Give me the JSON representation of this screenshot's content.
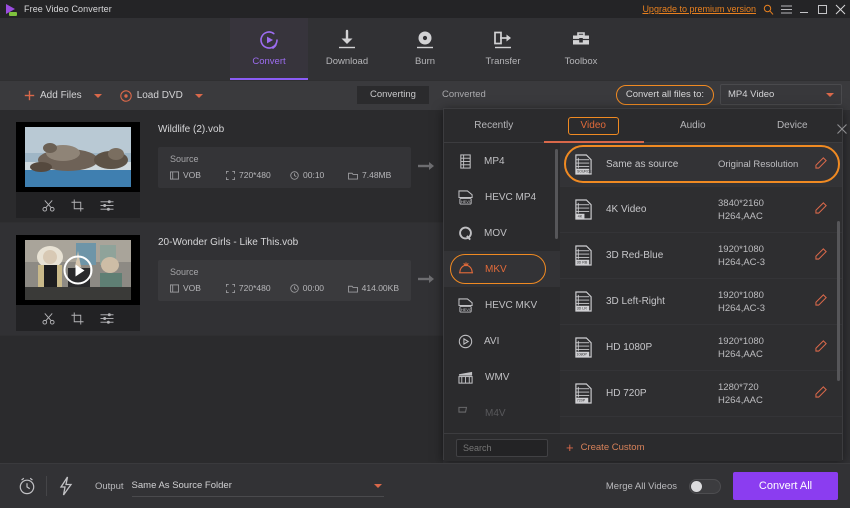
{
  "titlebar": {
    "app_title": "Free Video Converter",
    "upgrade_label": "Upgrade to premium version",
    "icons": [
      "search-icon",
      "menu-icon",
      "minimize-icon",
      "maximize-icon",
      "close-icon"
    ]
  },
  "nav": {
    "items": [
      {
        "label": "Convert",
        "icon": "convert-icon",
        "active": true
      },
      {
        "label": "Download",
        "icon": "download-icon",
        "active": false
      },
      {
        "label": "Burn",
        "icon": "burn-icon",
        "active": false
      },
      {
        "label": "Transfer",
        "icon": "transfer-icon",
        "active": false
      },
      {
        "label": "Toolbox",
        "icon": "toolbox-icon",
        "active": false
      }
    ]
  },
  "toolbar": {
    "add_files_label": "Add Files",
    "load_dvd_label": "Load DVD",
    "tabs": [
      {
        "label": "Converting",
        "active": true
      },
      {
        "label": "Converted",
        "active": false
      }
    ],
    "convert_all_to_label": "Convert all files to:",
    "convert_all_to_value": "MP4 Video"
  },
  "files": [
    {
      "name": "Wildlife  (2).vob",
      "source_label": "Source",
      "format": "VOB",
      "resolution": "720*480",
      "duration": "00:10",
      "size": "7.48MB",
      "playing": false
    },
    {
      "name": "20-Wonder Girls - Like This.vob",
      "source_label": "Source",
      "format": "VOB",
      "resolution": "720*480",
      "duration": "00:00",
      "size": "414.00KB",
      "playing": true
    }
  ],
  "panel": {
    "tabs": [
      {
        "label": "Recently",
        "active": false
      },
      {
        "label": "Video",
        "active": true
      },
      {
        "label": "Audio",
        "active": false
      },
      {
        "label": "Device",
        "active": false
      }
    ],
    "formats": [
      {
        "label": "MP4",
        "icon": "mp4-icon",
        "selected": false
      },
      {
        "label": "HEVC MP4",
        "icon": "hevc-mp4-icon",
        "selected": false
      },
      {
        "label": "MOV",
        "icon": "mov-icon",
        "selected": false
      },
      {
        "label": "MKV",
        "icon": "mkv-icon",
        "selected": true
      },
      {
        "label": "HEVC MKV",
        "icon": "hevc-mkv-icon",
        "selected": false
      },
      {
        "label": "AVI",
        "icon": "avi-icon",
        "selected": false
      },
      {
        "label": "WMV",
        "icon": "wmv-icon",
        "selected": false
      },
      {
        "label": "M4V",
        "icon": "m4v-icon",
        "selected": false
      }
    ],
    "presets": [
      {
        "name": "Same as source",
        "resolution": "Original Resolution",
        "codec": "",
        "highlighted": true
      },
      {
        "name": "4K Video",
        "resolution": "3840*2160",
        "codec": "H264,AAC",
        "highlighted": false
      },
      {
        "name": "3D Red-Blue",
        "resolution": "1920*1080",
        "codec": "H264,AC-3",
        "highlighted": false
      },
      {
        "name": "3D Left-Right",
        "resolution": "1920*1080",
        "codec": "H264,AC-3",
        "highlighted": false
      },
      {
        "name": "HD 1080P",
        "resolution": "1920*1080",
        "codec": "H264,AAC",
        "highlighted": false
      },
      {
        "name": "HD 720P",
        "resolution": "1280*720",
        "codec": "H264,AAC",
        "highlighted": false
      }
    ],
    "search_placeholder": "Search",
    "create_custom_label": "Create Custom"
  },
  "bottombar": {
    "output_label": "Output",
    "output_value": "Same As Source Folder",
    "merge_label": "Merge All Videos",
    "merge_on": false,
    "convert_all_label": "Convert All"
  },
  "colors": {
    "accent_purple": "#8b3df0",
    "accent_orange": "#f08a22",
    "link_orange": "#e8801f",
    "bg_dark": "#2b2b2d"
  }
}
